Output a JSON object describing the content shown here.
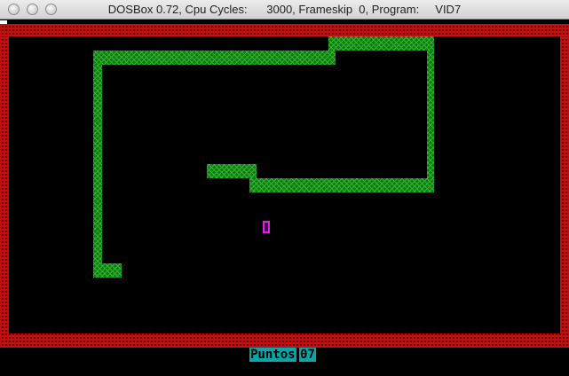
{
  "window": {
    "title": "DOSBox 0.72, Cpu Cycles:      3000, Frameskip  0, Program:     VID7",
    "titlebar_color": "#d8d8d8"
  },
  "game": {
    "score_label": "Puntos",
    "score_value": "07",
    "colors": {
      "background": "#000000",
      "wall": "#c41010",
      "snake": "#2fb42f",
      "food": "#e020e0",
      "score_bg": "#00a8a8"
    }
  }
}
